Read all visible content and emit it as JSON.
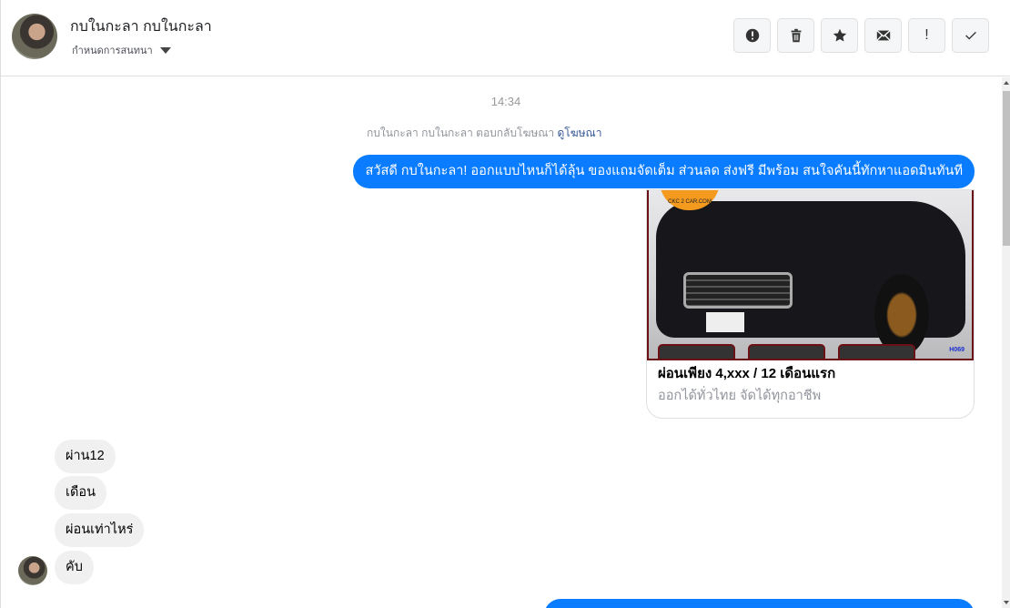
{
  "header": {
    "contact_name": "กบในกะลา กบในกะลา",
    "conversation_settings": "กำหนดการสนทนา",
    "actions": [
      {
        "icon": "alert-circle-icon"
      },
      {
        "icon": "trash-icon"
      },
      {
        "icon": "star-icon"
      },
      {
        "icon": "mail-icon"
      },
      {
        "icon": "exclamation-icon",
        "label": "!"
      },
      {
        "icon": "check-icon"
      }
    ]
  },
  "chat": {
    "timestamp": "14:34",
    "ad_reply_text": "กบในกะลา กบในกะลา ตอบกลับโฆษณา",
    "ad_link": "ดูโฆษณา",
    "outgoing_message": "สวัสดี กบในกะลา! ออกแบบไหนก็ได้ลุ้น ของแถมจัดเต็ม ส่วนลด ส่งฟรี มีพร้อม สนใจคันนี้ทักหาแอดมินทันที",
    "ad_card": {
      "logo_text": "CKC 2 CAR.COM",
      "code": "H069",
      "title": "ผ่อนเพียง 4,xxx / 12 เดือนแรก",
      "subtitle": "ออกได้ทั่วไทย จัดได้ทุกอาชีพ"
    },
    "incoming_messages": [
      "ผ่าน12",
      "เดือน",
      "ผ่อนเท่าไหร่",
      "คับ"
    ]
  }
}
